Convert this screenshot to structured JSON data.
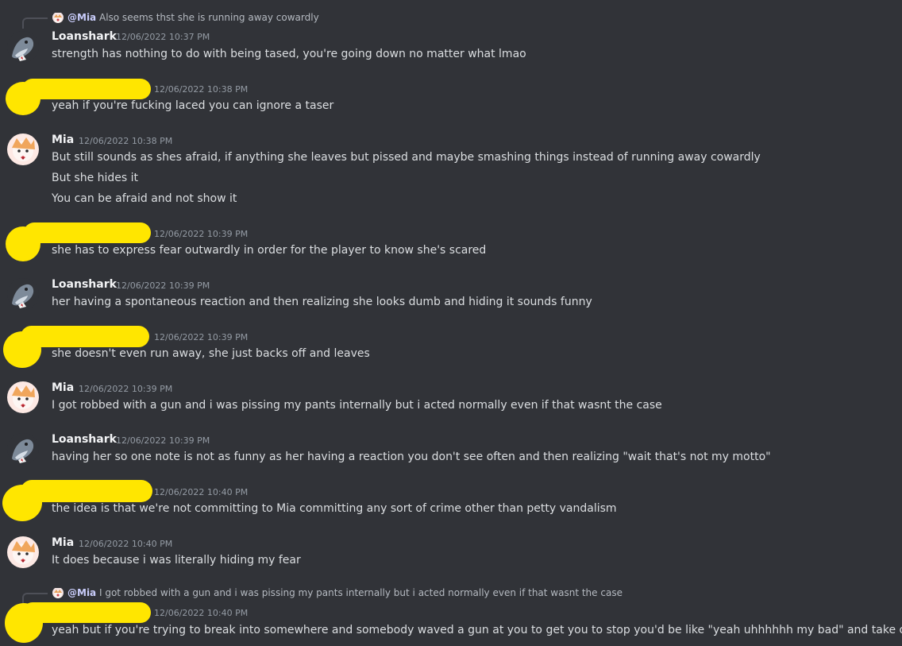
{
  "messages": [
    {
      "reply": {
        "mention": "@Mia",
        "text": "Also seems thst she is running away cowardly"
      },
      "username": "Loanshark",
      "timestamp": "12/06/2022 10:37 PM",
      "lines": [
        "strength has nothing to do with being tased, you're going down no matter what lmao"
      ]
    },
    {
      "username": "",
      "timestamp": "12/06/2022 10:38 PM",
      "lines": [
        "yeah if you're fucking laced you can ignore a taser"
      ]
    },
    {
      "username": "Mia",
      "timestamp": "12/06/2022 10:38 PM",
      "lines": [
        "But still sounds as shes afraid, if anything she leaves but pissed and maybe smashing things instead of running away cowardly",
        "But she hides it",
        "You can be afraid and not show it"
      ]
    },
    {
      "username": "",
      "timestamp": "12/06/2022 10:39 PM",
      "lines": [
        "she has to express fear outwardly in order for the player to know she's scared"
      ]
    },
    {
      "username": "Loanshark",
      "timestamp": "12/06/2022 10:39 PM",
      "lines": [
        "her having a spontaneous reaction and then realizing she looks dumb and hiding it sounds funny"
      ]
    },
    {
      "username": "",
      "timestamp": "12/06/2022 10:39 PM",
      "lines": [
        "she doesn't even run away, she just backs off and leaves"
      ]
    },
    {
      "username": "Mia",
      "timestamp": "12/06/2022 10:39 PM",
      "lines": [
        "I got robbed with a gun and i was pissing my pants internally but i acted normally even if that wasnt the case"
      ]
    },
    {
      "username": "Loanshark",
      "timestamp": "12/06/2022 10:39 PM",
      "lines": [
        "having her so one note is not as funny as her having a reaction you don't see often and then realizing \"wait that's not my motto\""
      ]
    },
    {
      "username": "",
      "timestamp": "12/06/2022 10:40 PM",
      "lines": [
        "the idea is that we're not committing to Mia committing any sort of crime other than petty vandalism"
      ]
    },
    {
      "username": "Mia",
      "timestamp": "12/06/2022 10:40 PM",
      "lines": [
        "It does because i was literally hiding my fear"
      ]
    },
    {
      "reply": {
        "mention": "@Mia",
        "text": "I got robbed with a gun and i was pissing my pants internally but i acted normally even if that wasnt the case"
      },
      "username": "",
      "timestamp": "12/06/2022 10:40 PM",
      "lines": [
        "yeah but if you're trying to break into somewhere and somebody waved a gun at you to get you to stop you'd be like \"yeah uhhhhhh my bad\" and take off"
      ]
    }
  ]
}
